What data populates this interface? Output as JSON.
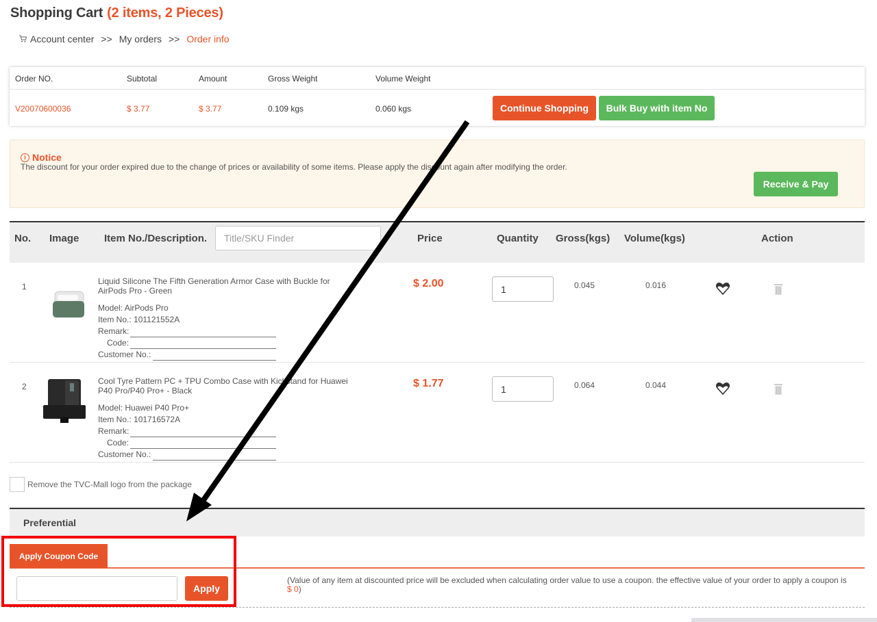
{
  "header": {
    "title": "Shopping Cart",
    "count_label": "(2 items, 2 Pieces)"
  },
  "breadcrumb": {
    "icon": "cart-icon",
    "items": [
      "Account center",
      "My orders",
      "Order info"
    ],
    "separator": ">>"
  },
  "order_summary": {
    "columns": [
      "Order NO.",
      "Subtotal",
      "Amount",
      "Gross Weight",
      "Volume Weight"
    ],
    "values": {
      "order_no": "V20070600036",
      "subtotal": "$ 3.77",
      "amount": "$ 3.77",
      "gross_weight": "0.109 kgs",
      "volume_weight": "0.060 kgs"
    },
    "buttons": {
      "continue_shopping": "Continue Shopping",
      "bulk_buy": "Bulk Buy with item No"
    }
  },
  "notice": {
    "icon": "info-icon",
    "title": "Notice",
    "message": "The discount for your order expired due to the change of prices or availability of some items. Please apply the discount again after modifying the order.",
    "pay_button": "Receive & Pay"
  },
  "items_table": {
    "columns": {
      "no": "No.",
      "image": "Image",
      "description": "Item No./Description.",
      "price": "Price",
      "quantity": "Quantity",
      "gross": "Gross(kgs)",
      "volume": "Volume(kgs)",
      "action": "Action"
    },
    "finder_placeholder": "Title/SKU Finder",
    "meta_labels": {
      "remark": "Remark:",
      "code": "Code:",
      "customer_no": "Customer No.:"
    },
    "rows": [
      {
        "no": "1",
        "title": "Liquid Silicone The Fifth Generation Armor Case with Buckle for AirPods Pro - Green",
        "model": "Model: AirPods Pro",
        "item_no": "Item No.: 101121552A",
        "price": "$ 2.00",
        "quantity": "1",
        "gross": "0.045",
        "volume": "0.016"
      },
      {
        "no": "2",
        "title": "Cool Tyre Pattern PC + TPU Combo Case with Kickstand for Huawei P40 Pro/P40 Pro+ - Black",
        "model": "Model: Huawei P40 Pro+",
        "item_no": "Item No.: 101716572A",
        "price": "$ 1.77",
        "quantity": "1",
        "gross": "0.064",
        "volume": "0.044"
      }
    ]
  },
  "options": {
    "remove_logo_label": "Remove the TVC-Mall logo from the package",
    "remove_logo_checked": false
  },
  "preferential": {
    "title": "Preferential",
    "tab_label": "Apply Coupon Code",
    "coupon_value": "",
    "apply_button": "Apply",
    "note_prefix": "(Value of any item at discounted price will be excluded when calculating order value to use a coupon. the effective value of your order to apply a coupon is ",
    "note_value": "$ 0",
    "note_suffix": ")"
  },
  "colors": {
    "accent": "#e8542a",
    "success": "#5cb85c",
    "notice_bg": "#fdf6ea",
    "annotation_red": "#f20000"
  }
}
